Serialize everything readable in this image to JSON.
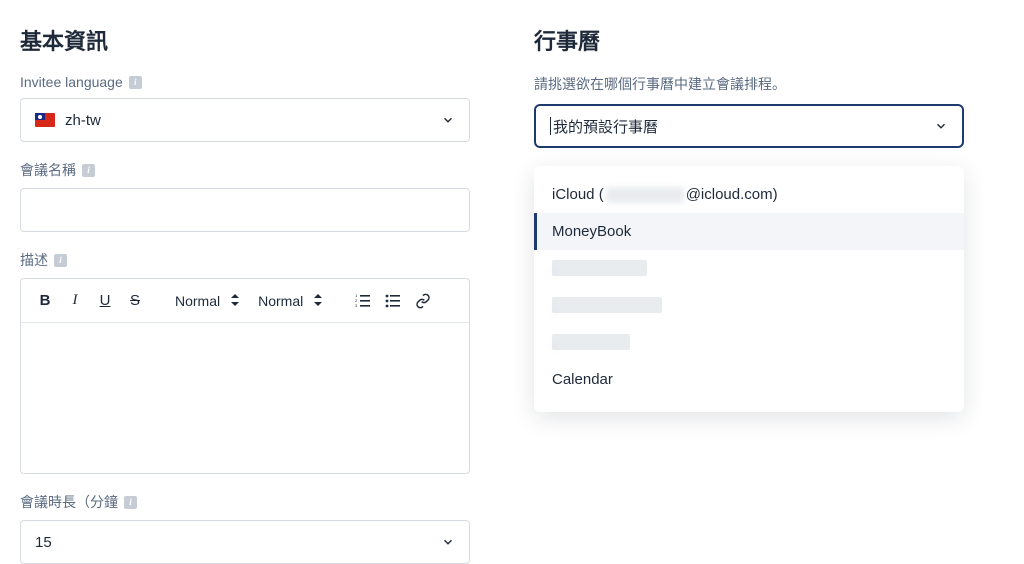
{
  "left": {
    "section_title": "基本資訊",
    "invitee_language_label": "Invitee language",
    "language_value": "zh-tw",
    "meeting_name_label": "會議名稱",
    "description_label": "描述",
    "toolbar": {
      "bold": "B",
      "italic": "I",
      "underline": "U",
      "strike": "S",
      "normal1": "Normal",
      "normal2": "Normal"
    },
    "duration_label": "會議時長（分鐘",
    "duration_value": "15"
  },
  "right": {
    "section_title": "行事曆",
    "helper": "請挑選欲在哪個行事曆中建立會議排程。",
    "selected": "我的預設行事曆",
    "group_prefix": "iCloud (",
    "group_suffix": "@icloud.com)",
    "options": {
      "o1": "MoneyBook",
      "o5": "Calendar"
    }
  }
}
